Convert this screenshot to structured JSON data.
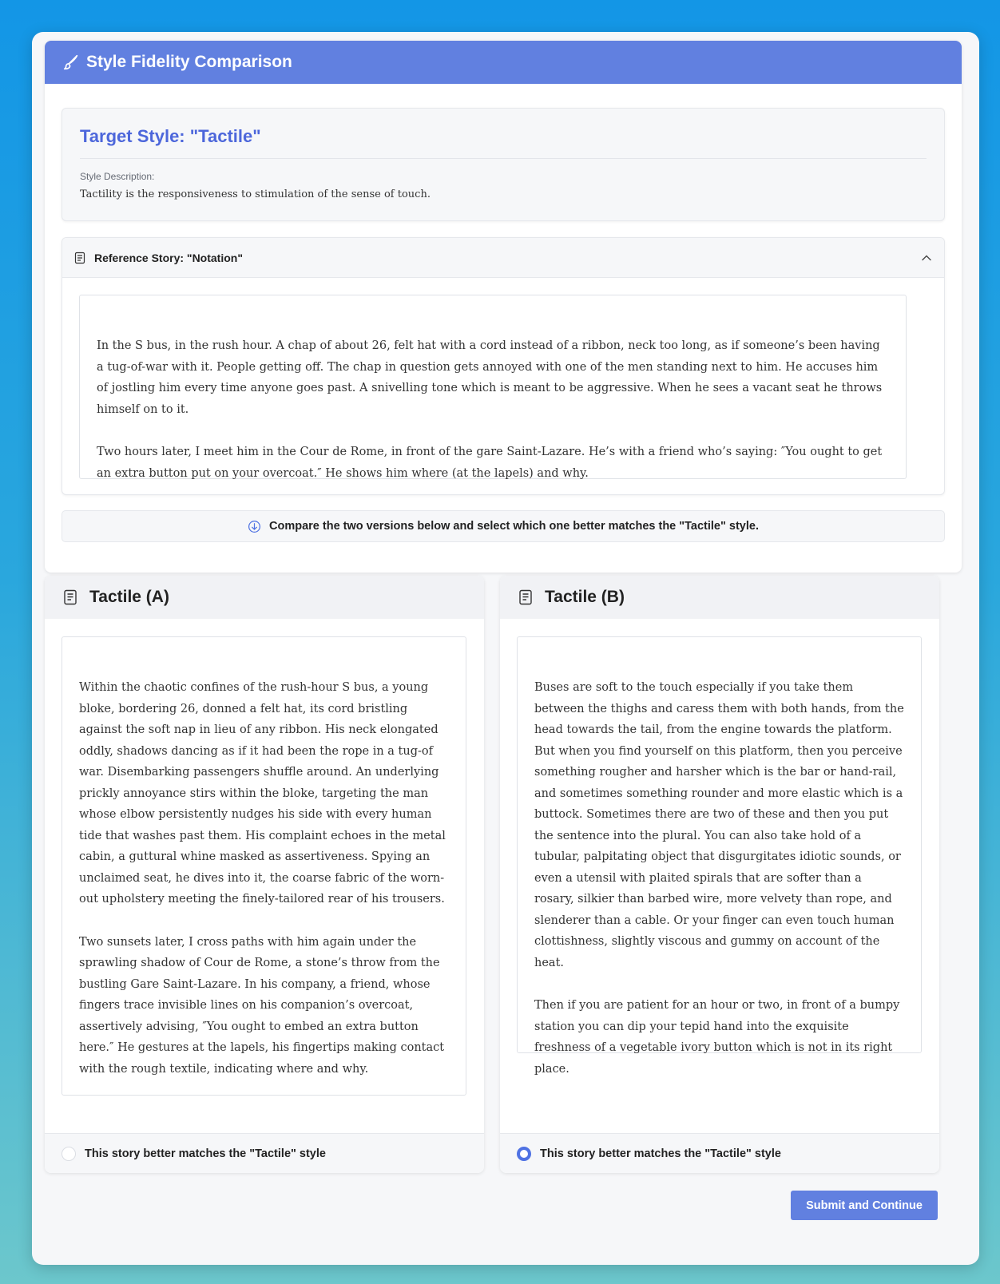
{
  "header": {
    "title": "Style Fidelity Comparison",
    "icon": "paintbrush-icon",
    "color": "#6180e0"
  },
  "target": {
    "title": "Target Style: \"Tactile\"",
    "description_label": "Style Description:",
    "description": "Tactility is the responsiveness to stimulation of the sense of touch."
  },
  "reference": {
    "title": "Reference Story: \"Notation\"",
    "expanded": true,
    "paragraphs": [
      "In the S bus, in the rush hour. A chap of about 26, felt hat with a cord instead of a ribbon, neck too long, as if someone’s been having a tug-of-war with it. People getting off. The chap in question gets annoyed with one of the men standing next to him. He accuses him of jostling him every time anyone goes past. A snivelling tone which is meant to be aggressive. When he sees a vacant seat he throws himself on to it.",
      "Two hours later, I meet him in the Cour de Rome, in front of the gare Saint-Lazare. He’s with a friend who’s saying: ″You ought to get an extra button put on your overcoat.″ He shows him where (at the lapels) and why."
    ]
  },
  "instruction": "Compare the two versions below and select which one better matches the \"Tactile\" style.",
  "story_a": {
    "title": "Tactile (A)",
    "paragraphs": [
      "Within the chaotic confines of the rush-hour S bus, a young bloke, bordering 26, donned a felt hat, its cord bristling against the soft nap in lieu of any ribbon. His neck elongated oddly, shadows dancing as if it had been the rope in a tug-of war. Disembarking passengers shuffle around. An underlying prickly annoyance stirs within the bloke, targeting the man whose elbow persistently nudges his side with every human tide that washes past them. His complaint echoes in the metal cabin, a guttural whine masked as assertiveness. Spying an unclaimed seat, he dives into it, the coarse fabric of the worn-out upholstery meeting the finely-tailored rear of his trousers.",
      "Two sunsets later, I cross paths with him again under the sprawling shadow of Cour de Rome, a stone’s throw from the bustling Gare Saint-Lazare. In his company, a friend, whose fingers trace invisible lines on his companion’s overcoat, assertively advising, ″You ought to embed an extra button here.″ He gestures at the lapels, his fingertips making contact with the rough textile, indicating where and why."
    ],
    "choice_label": "This story better matches the \"Tactile\" style",
    "selected": false
  },
  "story_b": {
    "title": "Tactile (B)",
    "paragraphs": [
      "Buses are soft to the touch especially if you take them between the thighs and caress them with both hands, from the head towards the tail, from the engine towards the platform. But when you find yourself on this platform, then you perceive something rougher and harsher which is the bar or hand-rail, and sometimes something rounder and more elastic which is a buttock. Sometimes there are two of these and then you put the sentence into the plural. You can also take hold of a tubular, palpitating object that disgurgitates idiotic sounds, or even a utensil with plaited spirals that are softer than a rosary, silkier than barbed wire, more velvety than rope, and slenderer than a cable. Or your finger can even touch human clottishness, slightly viscous and gummy on account of the heat.",
      "Then if you are patient for an hour or two, in front of a bumpy station you can dip your tepid hand into the exquisite freshness of a vegetable ivory button which is not in its right place."
    ],
    "choice_label": "This story better matches the \"Tactile\" style",
    "selected": true
  },
  "submit_label": "Submit and Continue"
}
